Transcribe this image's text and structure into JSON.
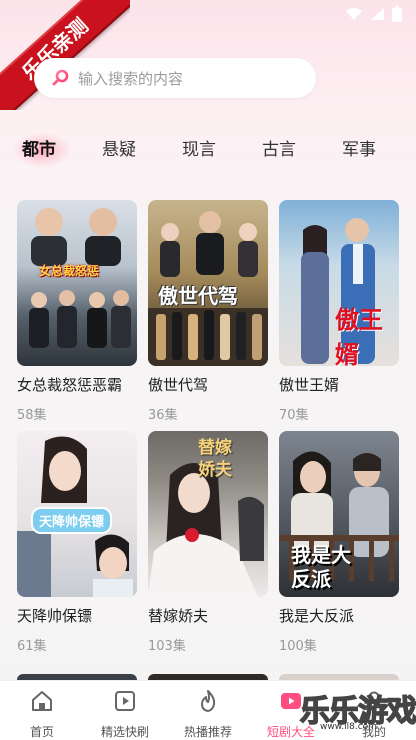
{
  "ribbon": {
    "text": "乐乐亲测"
  },
  "search": {
    "placeholder": "输入搜索的内容"
  },
  "tabs": [
    {
      "label": "都市",
      "active": true
    },
    {
      "label": "悬疑",
      "active": false
    },
    {
      "label": "现言",
      "active": false
    },
    {
      "label": "古言",
      "active": false
    },
    {
      "label": "军事",
      "active": false
    }
  ],
  "dramas": [
    {
      "title": "女总裁怒惩恶霸",
      "episodes": "58集",
      "poster_text": "女总裁怒惩"
    },
    {
      "title": "傲世代驾",
      "episodes": "36集",
      "poster_text": "傲世代驾"
    },
    {
      "title": "傲世王婿",
      "episodes": "70集",
      "poster_text": "傲王婿"
    },
    {
      "title": "天降帅保镖",
      "episodes": "61集",
      "poster_text": "天降帅保镖"
    },
    {
      "title": "替嫁娇夫",
      "episodes": "103集",
      "poster_text": "替嫁娇夫"
    },
    {
      "title": "我是大反派",
      "episodes": "100集",
      "poster_text": "我是大反派"
    }
  ],
  "nav": [
    {
      "label": "首页",
      "icon": "home-icon"
    },
    {
      "label": "精选快刷",
      "icon": "play-square-icon"
    },
    {
      "label": "热播推荐",
      "icon": "flame-icon"
    },
    {
      "label": "短剧大全",
      "icon": "tv-play-icon",
      "active": true
    },
    {
      "label": "我的",
      "icon": "user-icon"
    }
  ],
  "watermark": {
    "text": "乐乐游戏",
    "url": "www.ll8.com"
  },
  "colors": {
    "accent": "#ff4d7f",
    "ribbon": "#c9121d"
  }
}
